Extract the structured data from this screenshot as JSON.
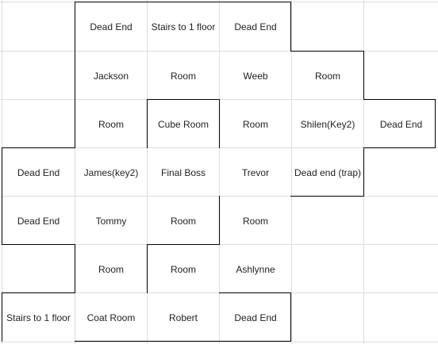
{
  "grid": {
    "rows": [
      [
        "",
        "Dead End",
        "Stairs to 1 floor",
        "Dead End",
        "",
        ""
      ],
      [
        "",
        "Jackson",
        "Room",
        "Weeb",
        "Room",
        ""
      ],
      [
        "",
        "Room",
        "Cube Room",
        "Room",
        "Shilen(Key2)",
        "Dead End"
      ],
      [
        "Dead End",
        "James(key2)",
        "Final Boss",
        "Trevor",
        "Dead end (trap)",
        ""
      ],
      [
        "Dead End",
        "Tommy",
        "Room",
        "Room",
        "",
        ""
      ],
      [
        "",
        "Room",
        "Room",
        "Ashlynne",
        "",
        ""
      ],
      [
        "Stairs to 1 floor",
        "Coat Room",
        "Robert",
        "Dead End",
        "",
        ""
      ]
    ]
  }
}
